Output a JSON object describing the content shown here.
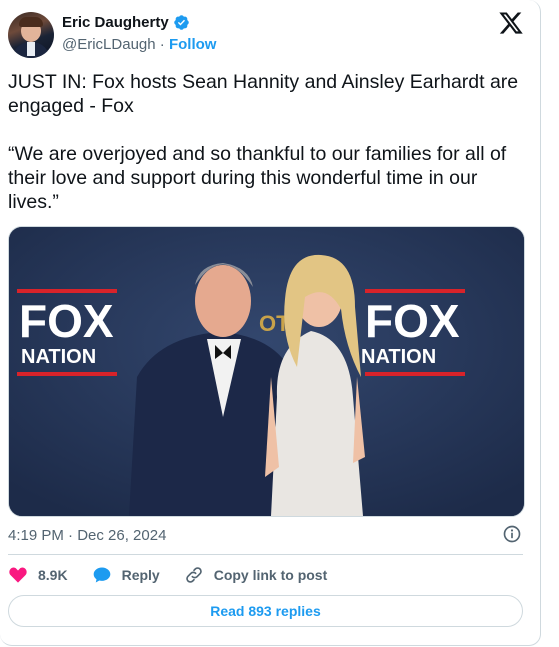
{
  "author": {
    "display_name": "Eric Daugherty",
    "handle": "@EricLDaugh",
    "separator": " · ",
    "follow_label": "Follow"
  },
  "tweet": {
    "text": "JUST IN: Fox hosts Sean Hannity and Ainsley Earhardt are engaged - Fox\n\n“We are overjoyed and so thankful to our families for all of their love and support during this wonderful time in our lives.”",
    "timestamp": "4:19 PM · Dec 26, 2024"
  },
  "media": {
    "backdrop_logo_top": "FOX",
    "backdrop_logo_bottom": "NATION",
    "backdrop_logo_bottom_right": "NATION",
    "backdrop_partial": "OT"
  },
  "actions": {
    "likes": "8.9K",
    "reply_label": "Reply",
    "copy_label": "Copy link to post"
  },
  "read_replies_label": "Read 893 replies",
  "colors": {
    "accent": "#1d9bf0",
    "like": "#f91880",
    "text": "#0f1419",
    "muted": "#536471",
    "border": "#cfd9de"
  },
  "icons": [
    "verified-badge-icon",
    "x-logo-icon",
    "info-icon",
    "heart-icon",
    "reply-bubble-icon",
    "link-icon"
  ]
}
